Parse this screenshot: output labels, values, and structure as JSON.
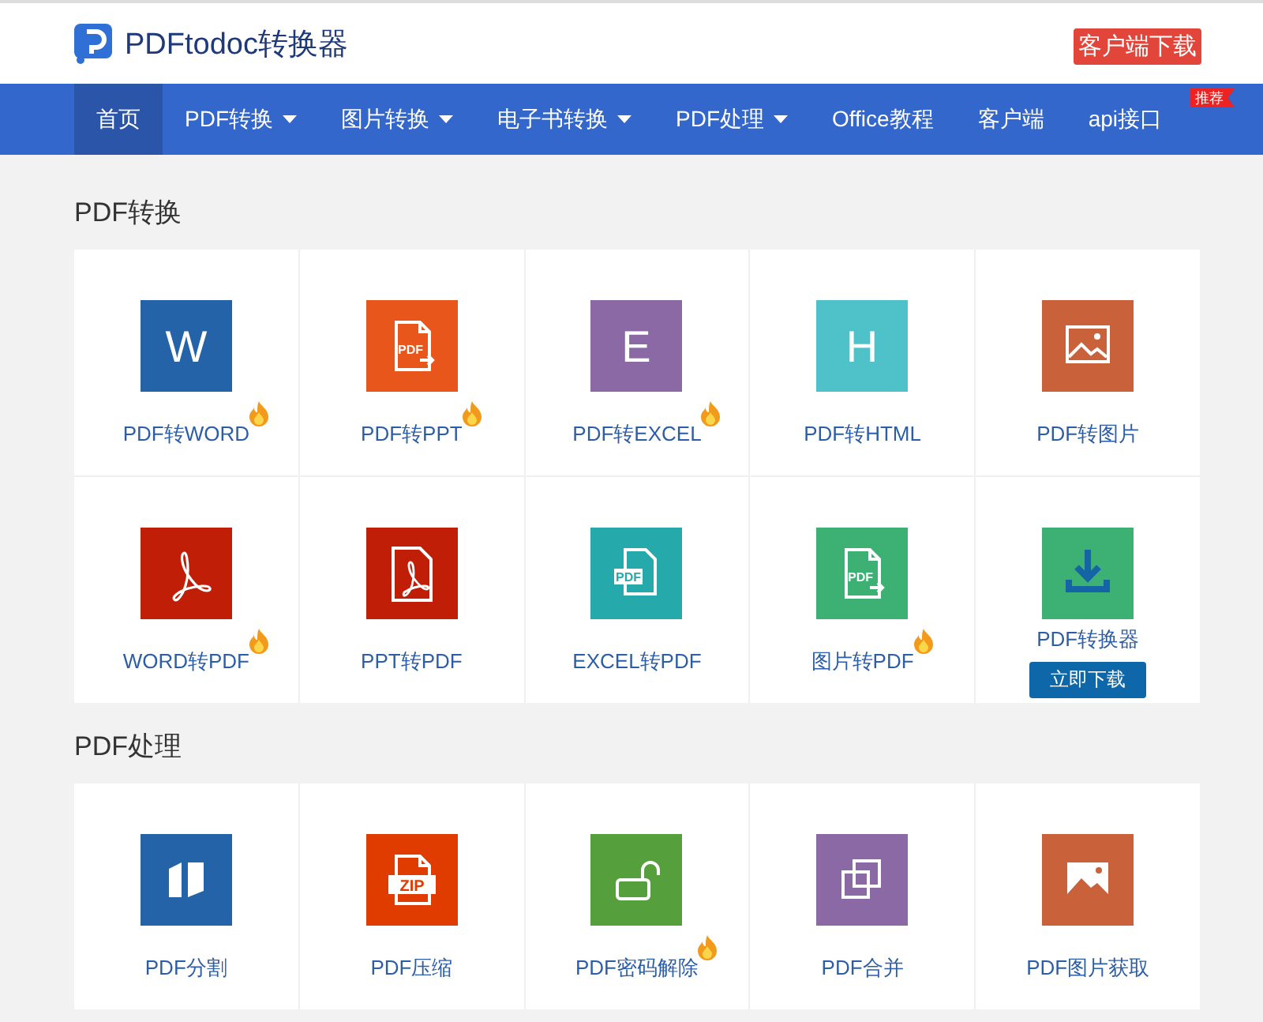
{
  "header": {
    "logo_title": "PDFtodoc转换器",
    "download_button": "客户端下载"
  },
  "nav": [
    {
      "label": "首页",
      "dropdown": false,
      "selected": true
    },
    {
      "label": "PDF转换",
      "dropdown": true,
      "selected": false
    },
    {
      "label": "图片转换",
      "dropdown": true,
      "selected": false
    },
    {
      "label": "电子书转换",
      "dropdown": true,
      "selected": false
    },
    {
      "label": "PDF处理",
      "dropdown": true,
      "selected": false
    },
    {
      "label": "Office教程",
      "dropdown": false,
      "selected": false
    },
    {
      "label": "客户端",
      "dropdown": false,
      "selected": false
    },
    {
      "label": "api接口",
      "dropdown": false,
      "selected": false,
      "badge": "推荐"
    }
  ],
  "sections": [
    {
      "title": "PDF转换",
      "tools": [
        {
          "kind": "letter",
          "icon_text": "W",
          "color": "#2563a8",
          "label": "PDF转WORD",
          "hot": true
        },
        {
          "kind": "doc-arrow",
          "icon_text": "PDF",
          "color": "#e8561c",
          "label": "PDF转PPT",
          "hot": true
        },
        {
          "kind": "letter",
          "icon_text": "E",
          "color": "#8b69a5",
          "label": "PDF转EXCEL",
          "hot": true
        },
        {
          "kind": "letter",
          "icon_text": "H",
          "color": "#4fc1c9",
          "label": "PDF转HTML",
          "hot": false
        },
        {
          "kind": "image",
          "color": "#c9613a",
          "label": "PDF转图片",
          "hot": false
        },
        {
          "kind": "acrobat",
          "color": "#c11e07",
          "label": "WORD转PDF",
          "hot": true
        },
        {
          "kind": "doc-acrobat",
          "color": "#c11e07",
          "label": "PPT转PDF",
          "hot": false
        },
        {
          "kind": "doc-label",
          "icon_text": "PDF",
          "color": "#26a9ab",
          "label": "EXCEL转PDF",
          "hot": false
        },
        {
          "kind": "doc-arrow",
          "icon_text": "PDF",
          "color": "#3db073",
          "label": "图片转PDF",
          "hot": true
        },
        {
          "kind": "download",
          "color": "#3db073",
          "label": "PDF转换器",
          "hot": false,
          "button": "立即下载"
        }
      ]
    },
    {
      "title": "PDF处理",
      "tools": [
        {
          "kind": "split",
          "color": "#2563a8",
          "label": "PDF分割",
          "hot": false
        },
        {
          "kind": "zip",
          "icon_text": "ZIP",
          "color": "#e03c00",
          "label": "PDF压缩",
          "hot": false
        },
        {
          "kind": "unlock",
          "color": "#55a03c",
          "label": "PDF密码解除",
          "hot": true
        },
        {
          "kind": "merge",
          "color": "#8b69a5",
          "label": "PDF合并",
          "hot": false
        },
        {
          "kind": "image-filled",
          "color": "#c9613a",
          "label": "PDF图片获取",
          "hot": false
        }
      ]
    }
  ]
}
